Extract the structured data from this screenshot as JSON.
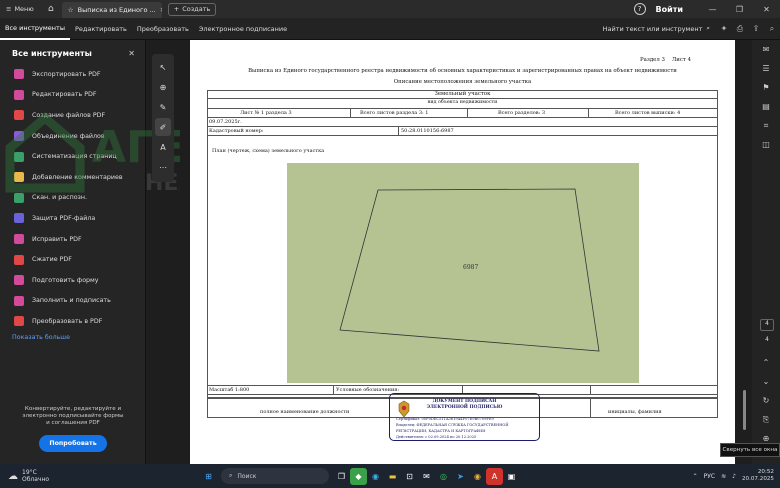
{
  "titlebar": {
    "menu_label": "Меню",
    "tab_title": "Выписка из Единого ...",
    "new_tab_label": "Создать",
    "login_label": "Войти"
  },
  "menubar": {
    "items": [
      "Все инструменты",
      "Редактировать",
      "Преобразовать",
      "Электронное подписание"
    ],
    "search_label": "Найти текст или инструмент"
  },
  "sidebar": {
    "title": "Все инструменты",
    "items": [
      {
        "label": "Экспортировать PDF",
        "color": "#d34a9a"
      },
      {
        "label": "Редактировать PDF",
        "color": "#d34a9a"
      },
      {
        "label": "Создание файлов PDF",
        "color": "#e04848"
      },
      {
        "label": "Объединение файлов",
        "color": "#8a5ad8"
      },
      {
        "label": "Систематизация страниц",
        "color": "#3aa06a"
      },
      {
        "label": "Добавление комментариев",
        "color": "#e8b84a"
      },
      {
        "label": "Скан. и распозн.",
        "color": "#3aa06a"
      },
      {
        "label": "Защита PDF-файла",
        "color": "#6a62d8"
      },
      {
        "label": "Исправить PDF",
        "color": "#d34a9a"
      },
      {
        "label": "Сжатие PDF",
        "color": "#e04848"
      },
      {
        "label": "Подготовить форму",
        "color": "#d34a9a"
      },
      {
        "label": "Заполнить и подписать",
        "color": "#d34a9a"
      },
      {
        "label": "Преобразовать в PDF",
        "color": "#e04848"
      }
    ],
    "show_more": "Показать больше",
    "promo_text": "Конвертируйте, редактируйте и электронно подписывайте формы и соглашения PDF",
    "promo_button": "Попробовать"
  },
  "watermark": {
    "brand": "АГЕНТ",
    "sub": "НЕДВИЖИМОСТЬ"
  },
  "document": {
    "section_line": "Раздел 3    Лист 4",
    "title1": "Выписка из Единого государственного реестра недвижимости об основных характеристиках и зарегистрированных правах на объект недвижимости",
    "title2": "Описание местоположения земельного участка",
    "object_type": "Земельный участок",
    "object_type_caption": "вид объекта недвижимости",
    "sheet_label": "Лист № 1 раздела 3",
    "sheets_section": "Всего листов раздела 3: 1",
    "sections_total": "Всего разделов: 3",
    "sheets_total": "Всего листов выписки: 4",
    "date": "09.07.2025г.",
    "cadastral_label": "Кадастровый номер:",
    "cadastral_number": "50:28.0110156:6987",
    "plan_label": "План (чертеж, схема) земельного участка",
    "plot_label": "6987",
    "plot_color": "#b5c393",
    "scale_label": "Масштаб 1:800",
    "legend_label": "Условные обозначения:",
    "position_label": "полное наименование должности",
    "name_label": "инициалы, фамилия"
  },
  "stamp": {
    "line1": "ДОКУМЕНТ ПОДПИСАН",
    "line2": "ЭЛЕКТРОННОЙ ПОДПИСЬЮ",
    "cert": "Сертификат: 00F0DEC511A3619A4F07E9B0709FE9",
    "owner": "Владелец: ФЕДЕРАЛЬНАЯ СЛУЖБА ГОСУДАРСТВЕННОЙ",
    "owner2": "РЕГИСТРАЦИИ, КАДАСТРА И КАРТОГРАФИИ",
    "valid": "Действителен: с 02.09.2024 по 20.12.2025"
  },
  "rightrail": {
    "page_current": "4",
    "page_total": "4"
  },
  "tooltip": "Свернуть все окна",
  "taskbar": {
    "temp": "19°C",
    "weather": "Облачно",
    "search": "Поиск",
    "lang": "РУС",
    "time": "20:52",
    "date": "20.07.2025"
  }
}
